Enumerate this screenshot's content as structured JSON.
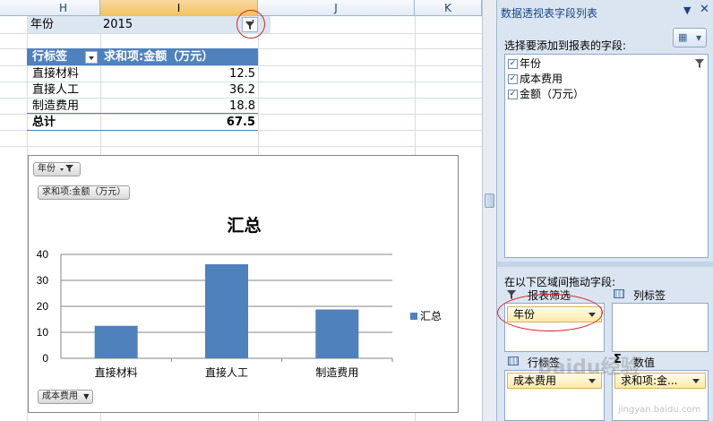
{
  "sheet": {
    "columns": [
      "H",
      "I",
      "J",
      "K"
    ],
    "filter_field": "年份",
    "filter_value": "2015",
    "pivot": {
      "row_header": "行标签",
      "value_header": "求和项:金额（万元）",
      "rows": [
        {
          "label": "直接材料",
          "value": "12.5"
        },
        {
          "label": "直接人工",
          "value": "36.2"
        },
        {
          "label": "制造费用",
          "value": "18.8"
        }
      ],
      "total_label": "总计",
      "total_value": "67.5"
    }
  },
  "chart": {
    "filter_chip": "年份",
    "value_chip": "求和项:金额（万元）",
    "axis_chip": "成本费用",
    "legend_label": "汇总",
    "bar_color": "#4f81bd"
  },
  "chart_data": {
    "type": "bar",
    "title": "汇总",
    "categories": [
      "直接材料",
      "直接人工",
      "制造费用"
    ],
    "series": [
      {
        "name": "汇总",
        "values": [
          12.5,
          36.2,
          18.8
        ]
      }
    ],
    "ylim": [
      0,
      40
    ],
    "yticks": [
      0,
      10,
      20,
      30,
      40
    ],
    "grid": true,
    "legend_position": "right"
  },
  "pane": {
    "title": "数据透视表字段列表",
    "choose_label": "选择要添加到报表的字段:",
    "fields": [
      {
        "label": "年份",
        "checked": true
      },
      {
        "label": "成本费用",
        "checked": true
      },
      {
        "label": "金额（万元）",
        "checked": true
      }
    ],
    "drag_label": "在以下区域间拖动字段:",
    "report_filter_label": "报表筛选",
    "column_labels_label": "列标签",
    "row_labels_label": "行标签",
    "values_label": "数值",
    "filter_chip": "年份",
    "row_chip": "成本费用",
    "value_chip": "求和项:金..."
  },
  "watermark": {
    "main": "Baidu经验",
    "sub": "jingyan.baidu.com"
  }
}
